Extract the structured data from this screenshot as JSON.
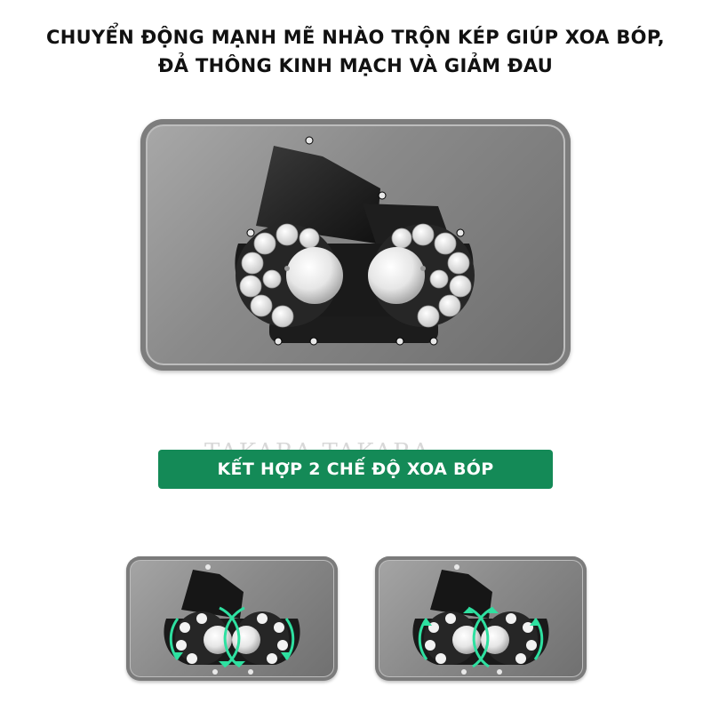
{
  "headline": {
    "line1": "CHUYỂN ĐỘNG MẠNH MẼ NHÀO TRỘN KÉP GIÚP XOA BÓP,",
    "line2": "ĐẢ THÔNG KINH MẠCH VÀ GIẢM ĐAU"
  },
  "watermark": "TAKARA TAKARA",
  "banner": {
    "label": "KẾT HỢP 2 CHẾ ĐỘ XOA BÓP"
  },
  "modes": [
    {
      "direction": "inward"
    },
    {
      "direction": "outward"
    }
  ],
  "colors": {
    "banner": "#148a57",
    "arrow": "#2ee0a0",
    "panel": "#8a8a8a"
  }
}
